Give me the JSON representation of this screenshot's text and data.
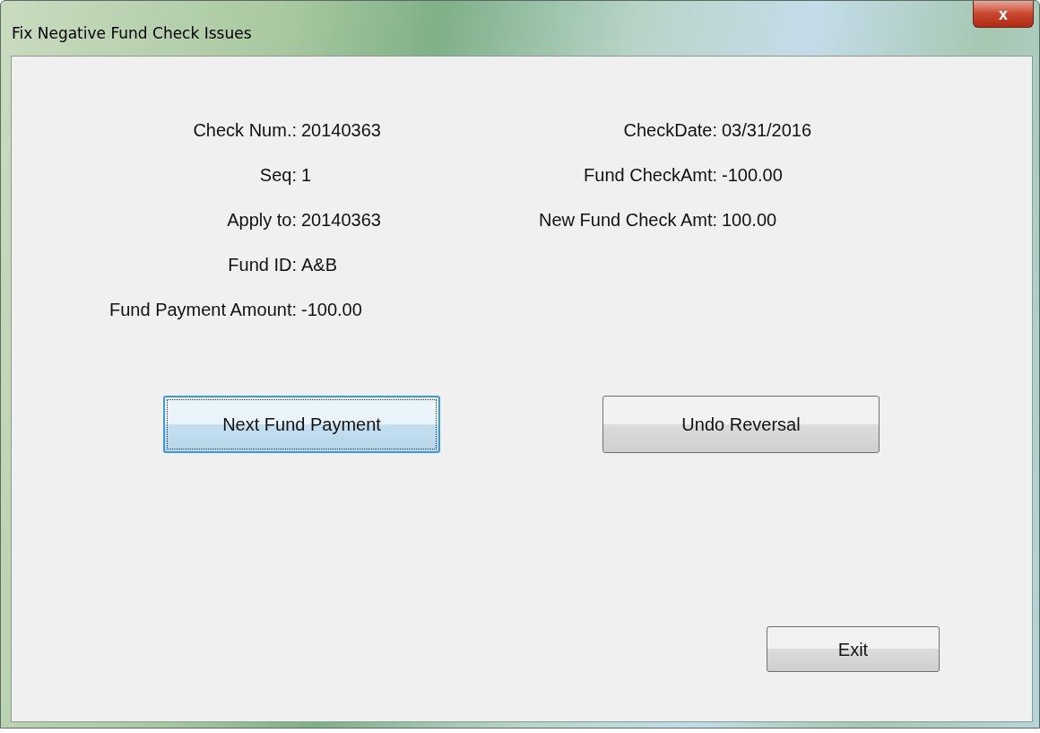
{
  "window": {
    "title": "Fix Negative Fund Check Issues",
    "close_label": "x"
  },
  "left_fields": [
    {
      "label": "Check Num.:",
      "value": "20140363"
    },
    {
      "label": "Seq:",
      "value": "1"
    },
    {
      "label": "Apply to:",
      "value": "20140363"
    },
    {
      "label": "Fund ID:",
      "value": "A&B"
    },
    {
      "label": "Fund Payment Amount:",
      "value": "-100.00"
    }
  ],
  "right_fields": [
    {
      "label": "CheckDate:",
      "value": "03/31/2016"
    },
    {
      "label": "Fund CheckAmt:",
      "value": "-100.00"
    },
    {
      "label": "New Fund Check Amt:",
      "value": "100.00"
    }
  ],
  "buttons": [
    {
      "label": "Next Fund Payment",
      "focused": true
    },
    {
      "label": "Undo Reversal",
      "focused": false
    }
  ],
  "exit_button": {
    "label": "Exit",
    "focused": false
  }
}
